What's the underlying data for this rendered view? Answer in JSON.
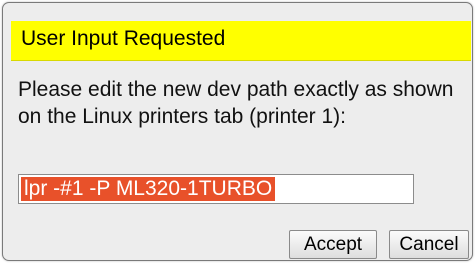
{
  "dialog": {
    "title": "User Input Requested",
    "message": "Please edit the new dev path exactly as shown on the Linux printers tab (printer 1):",
    "input": {
      "value": "lpr -#1 -P ML320-1TURBO",
      "selected": true
    },
    "buttons": {
      "accept_label": "Accept",
      "cancel_label": "Cancel"
    }
  },
  "colors": {
    "titlebar": "#ffff00",
    "dialog_background": "#ededed",
    "selection_background": "#e8512a",
    "selection_text": "#ffffff"
  }
}
